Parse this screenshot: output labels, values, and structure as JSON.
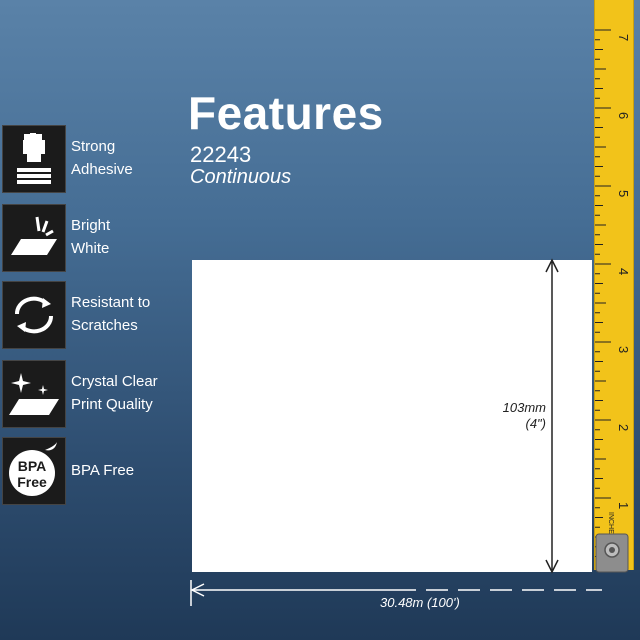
{
  "header": {
    "title": "Features",
    "product_code": "22243",
    "product_type": "Continuous"
  },
  "features": [
    {
      "icon": "fist-on-stack-icon",
      "line1": "Strong",
      "line2": "Adhesive"
    },
    {
      "icon": "bright-label-icon",
      "line1": "Bright",
      "line2": "White"
    },
    {
      "icon": "recycle-arrows-icon",
      "line1": "Resistant to",
      "line2": "Scratches"
    },
    {
      "icon": "sparkle-label-icon",
      "line1": "Crystal Clear",
      "line2": "Print Quality"
    },
    {
      "icon": "bpa-free-badge-icon",
      "line1": "BPA Free",
      "line2": ""
    }
  ],
  "bpa_badge": {
    "line1": "BPA",
    "line2": "Free"
  },
  "dimensions": {
    "height_mm": "103mm",
    "height_in": "(4\")",
    "length": "30.48m  (100')"
  },
  "tape_measure": {
    "numbers": [
      "7",
      "6",
      "5",
      "4",
      "3",
      "2",
      "1"
    ],
    "unit_label": "INCHES"
  },
  "colors": {
    "background_top": "#5a82a8",
    "background_bottom": "#1f3957",
    "tape_yellow": "#f2c31a",
    "icon_box": "#1b1b1b"
  }
}
